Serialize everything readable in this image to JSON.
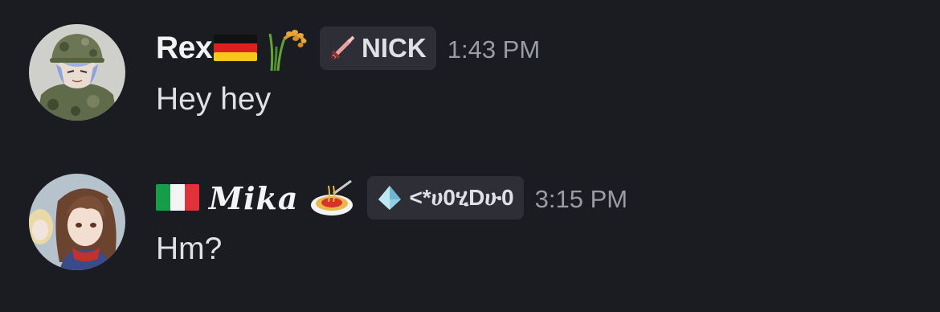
{
  "messages": [
    {
      "username": "Rex",
      "username_emojis": [
        "flag-germany",
        "sheaf-of-rice"
      ],
      "tag": {
        "icon": "pixel-sword-icon",
        "text": "NICK"
      },
      "timestamp": "1:43 PM",
      "text": "Hey hey"
    },
    {
      "username": "Mika",
      "username_prefix_emoji": "flag-italy",
      "username_suffix_emoji": "spaghetti",
      "tag": {
        "icon": "diamond-drop-icon",
        "text": "<*ሀ0ሂDሁ0"
      },
      "timestamp": "3:15 PM",
      "text": "Hm?"
    }
  ],
  "colors": {
    "background": "#1b1c21",
    "username": "#f2f3f5",
    "message_text": "#dfe1e5",
    "timestamp": "#9a9ca3",
    "tag_background": "#2e2f36"
  }
}
